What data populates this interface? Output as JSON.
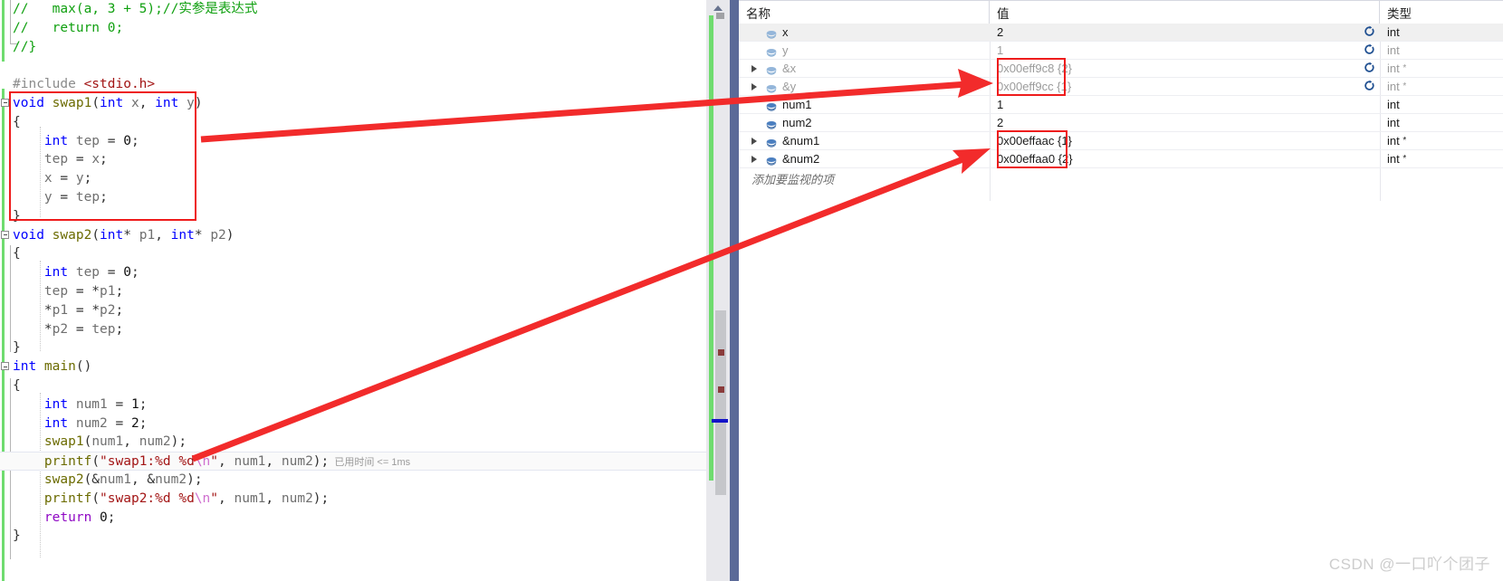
{
  "editor": {
    "lines": [
      {
        "indent": 0,
        "fold": false,
        "tokens": [
          {
            "t": "//   max(a, 3 + 5);//实参是表达式",
            "c": "c-com"
          }
        ]
      },
      {
        "indent": 0,
        "fold": false,
        "tokens": [
          {
            "t": "//   return 0;",
            "c": "c-com"
          }
        ]
      },
      {
        "indent": 0,
        "fold": false,
        "tokens": [
          {
            "t": "//}",
            "c": "c-com"
          }
        ]
      },
      {
        "indent": 0,
        "fold": false,
        "tokens": []
      },
      {
        "indent": 0,
        "fold": false,
        "tokens": [
          {
            "t": "#include ",
            "c": "c-pre"
          },
          {
            "t": "<stdio.h>",
            "c": "c-hdr"
          }
        ]
      },
      {
        "indent": 0,
        "fold": true,
        "tokens": [
          {
            "t": "void ",
            "c": "c-key"
          },
          {
            "t": "swap1",
            "c": "c-fn"
          },
          {
            "t": "(",
            "c": "c-pun"
          },
          {
            "t": "int ",
            "c": "c-key"
          },
          {
            "t": "x",
            "c": "c-id"
          },
          {
            "t": ", ",
            "c": "c-pun"
          },
          {
            "t": "int ",
            "c": "c-key"
          },
          {
            "t": "y",
            "c": "c-id"
          },
          {
            "t": ")",
            "c": "c-pun"
          }
        ]
      },
      {
        "indent": 0,
        "fold": false,
        "tokens": [
          {
            "t": "{",
            "c": "c-pun"
          }
        ]
      },
      {
        "indent": 0,
        "fold": false,
        "tokens": [
          {
            "t": "    int ",
            "c": "c-key"
          },
          {
            "t": "tep",
            "c": "c-id"
          },
          {
            "t": " = ",
            "c": "c-pun"
          },
          {
            "t": "0",
            "c": "c-num"
          },
          {
            "t": ";",
            "c": "c-pun"
          }
        ]
      },
      {
        "indent": 0,
        "fold": false,
        "tokens": [
          {
            "t": "    tep",
            "c": "c-id"
          },
          {
            "t": " = ",
            "c": "c-pun"
          },
          {
            "t": "x",
            "c": "c-id"
          },
          {
            "t": ";",
            "c": "c-pun"
          }
        ]
      },
      {
        "indent": 0,
        "fold": false,
        "tokens": [
          {
            "t": "    x",
            "c": "c-id"
          },
          {
            "t": " = ",
            "c": "c-pun"
          },
          {
            "t": "y",
            "c": "c-id"
          },
          {
            "t": ";",
            "c": "c-pun"
          }
        ]
      },
      {
        "indent": 0,
        "fold": false,
        "tokens": [
          {
            "t": "    y",
            "c": "c-id"
          },
          {
            "t": " = ",
            "c": "c-pun"
          },
          {
            "t": "tep",
            "c": "c-id"
          },
          {
            "t": ";",
            "c": "c-pun"
          }
        ]
      },
      {
        "indent": 0,
        "fold": false,
        "tokens": [
          {
            "t": "}",
            "c": "c-pun"
          }
        ]
      },
      {
        "indent": 0,
        "fold": true,
        "tokens": [
          {
            "t": "void ",
            "c": "c-key"
          },
          {
            "t": "swap2",
            "c": "c-fn"
          },
          {
            "t": "(",
            "c": "c-pun"
          },
          {
            "t": "int",
            "c": "c-key"
          },
          {
            "t": "* ",
            "c": "c-pun"
          },
          {
            "t": "p1",
            "c": "c-id"
          },
          {
            "t": ", ",
            "c": "c-pun"
          },
          {
            "t": "int",
            "c": "c-key"
          },
          {
            "t": "* ",
            "c": "c-pun"
          },
          {
            "t": "p2",
            "c": "c-id"
          },
          {
            "t": ")",
            "c": "c-pun"
          }
        ]
      },
      {
        "indent": 0,
        "fold": false,
        "tokens": [
          {
            "t": "{",
            "c": "c-pun"
          }
        ]
      },
      {
        "indent": 0,
        "fold": false,
        "tokens": [
          {
            "t": "    int ",
            "c": "c-key"
          },
          {
            "t": "tep",
            "c": "c-id"
          },
          {
            "t": " = ",
            "c": "c-pun"
          },
          {
            "t": "0",
            "c": "c-num"
          },
          {
            "t": ";",
            "c": "c-pun"
          }
        ]
      },
      {
        "indent": 0,
        "fold": false,
        "tokens": [
          {
            "t": "    tep",
            "c": "c-id"
          },
          {
            "t": " = *",
            "c": "c-pun"
          },
          {
            "t": "p1",
            "c": "c-id"
          },
          {
            "t": ";",
            "c": "c-pun"
          }
        ]
      },
      {
        "indent": 0,
        "fold": false,
        "tokens": [
          {
            "t": "    *",
            "c": "c-pun"
          },
          {
            "t": "p1",
            "c": "c-id"
          },
          {
            "t": " = *",
            "c": "c-pun"
          },
          {
            "t": "p2",
            "c": "c-id"
          },
          {
            "t": ";",
            "c": "c-pun"
          }
        ]
      },
      {
        "indent": 0,
        "fold": false,
        "tokens": [
          {
            "t": "    *",
            "c": "c-pun"
          },
          {
            "t": "p2",
            "c": "c-id"
          },
          {
            "t": " = ",
            "c": "c-pun"
          },
          {
            "t": "tep",
            "c": "c-id"
          },
          {
            "t": ";",
            "c": "c-pun"
          }
        ]
      },
      {
        "indent": 0,
        "fold": false,
        "tokens": [
          {
            "t": "}",
            "c": "c-pun"
          }
        ]
      },
      {
        "indent": 0,
        "fold": true,
        "tokens": [
          {
            "t": "int ",
            "c": "c-key"
          },
          {
            "t": "main",
            "c": "c-fn"
          },
          {
            "t": "()",
            "c": "c-pun"
          }
        ]
      },
      {
        "indent": 0,
        "fold": false,
        "tokens": [
          {
            "t": "{",
            "c": "c-pun"
          }
        ]
      },
      {
        "indent": 0,
        "fold": false,
        "tokens": [
          {
            "t": "    int ",
            "c": "c-key"
          },
          {
            "t": "num1",
            "c": "c-id"
          },
          {
            "t": " = ",
            "c": "c-pun"
          },
          {
            "t": "1",
            "c": "c-num"
          },
          {
            "t": ";",
            "c": "c-pun"
          }
        ]
      },
      {
        "indent": 0,
        "fold": false,
        "tokens": [
          {
            "t": "    int ",
            "c": "c-key"
          },
          {
            "t": "num2",
            "c": "c-id"
          },
          {
            "t": " = ",
            "c": "c-pun"
          },
          {
            "t": "2",
            "c": "c-num"
          },
          {
            "t": ";",
            "c": "c-pun"
          }
        ]
      },
      {
        "indent": 0,
        "fold": false,
        "tokens": [
          {
            "t": "    ",
            "c": "c-pun"
          },
          {
            "t": "swap1",
            "c": "c-fn"
          },
          {
            "t": "(",
            "c": "c-pun"
          },
          {
            "t": "num1",
            "c": "c-id"
          },
          {
            "t": ", ",
            "c": "c-pun"
          },
          {
            "t": "num2",
            "c": "c-id"
          },
          {
            "t": ");",
            "c": "c-pun"
          }
        ]
      },
      {
        "indent": 0,
        "fold": false,
        "highlight": true,
        "tokens": [
          {
            "t": "    ",
            "c": "c-pun"
          },
          {
            "t": "printf",
            "c": "c-fn"
          },
          {
            "t": "(",
            "c": "c-pun"
          },
          {
            "t": "\"swap1:%d %d",
            "c": "c-str"
          },
          {
            "t": "\\n",
            "c": "c-esc"
          },
          {
            "t": "\"",
            "c": "c-str"
          },
          {
            "t": ", ",
            "c": "c-pun"
          },
          {
            "t": "num1",
            "c": "c-id"
          },
          {
            "t": ", ",
            "c": "c-pun"
          },
          {
            "t": "num2",
            "c": "c-id"
          },
          {
            "t": ");",
            "c": "c-pun"
          }
        ],
        "elapsed": "已用时间 <= 1ms"
      },
      {
        "indent": 0,
        "fold": false,
        "tokens": [
          {
            "t": "    ",
            "c": "c-pun"
          },
          {
            "t": "swap2",
            "c": "c-fn"
          },
          {
            "t": "(&",
            "c": "c-pun"
          },
          {
            "t": "num1",
            "c": "c-id"
          },
          {
            "t": ", &",
            "c": "c-pun"
          },
          {
            "t": "num2",
            "c": "c-id"
          },
          {
            "t": ");",
            "c": "c-pun"
          }
        ]
      },
      {
        "indent": 0,
        "fold": false,
        "tokens": [
          {
            "t": "    ",
            "c": "c-pun"
          },
          {
            "t": "printf",
            "c": "c-fn"
          },
          {
            "t": "(",
            "c": "c-pun"
          },
          {
            "t": "\"swap2:%d %d",
            "c": "c-str"
          },
          {
            "t": "\\n",
            "c": "c-esc"
          },
          {
            "t": "\"",
            "c": "c-str"
          },
          {
            "t": ", ",
            "c": "c-pun"
          },
          {
            "t": "num1",
            "c": "c-id"
          },
          {
            "t": ", ",
            "c": "c-pun"
          },
          {
            "t": "num2",
            "c": "c-id"
          },
          {
            "t": ");",
            "c": "c-pun"
          }
        ]
      },
      {
        "indent": 0,
        "fold": false,
        "tokens": [
          {
            "t": "    return ",
            "c": "c-ctl"
          },
          {
            "t": "0",
            "c": "c-num"
          },
          {
            "t": ";",
            "c": "c-pun"
          }
        ]
      },
      {
        "indent": 0,
        "fold": false,
        "tokens": [
          {
            "t": "}",
            "c": "c-pun"
          }
        ]
      }
    ]
  },
  "watch": {
    "columns": {
      "name": "名称",
      "value": "值",
      "type": "类型"
    },
    "placeholder": "添加要监视的项",
    "rows": [
      {
        "name": "x",
        "value": "2",
        "extra": "",
        "type": "int",
        "pointer": false,
        "expandable": false,
        "dimmed": false,
        "selected": true,
        "refresh": true,
        "dark_icon": false
      },
      {
        "name": "y",
        "value": "1",
        "extra": "",
        "type": "int",
        "pointer": false,
        "expandable": false,
        "dimmed": true,
        "selected": false,
        "refresh": true,
        "dark_icon": false
      },
      {
        "name": "&x",
        "value": "0x00eff9c8",
        "extra": " {2}",
        "type": "int",
        "pointer": true,
        "expandable": true,
        "dimmed": true,
        "selected": false,
        "refresh": true,
        "dark_icon": false
      },
      {
        "name": "&y",
        "value": "0x00eff9cc",
        "extra": " {1}",
        "type": "int",
        "pointer": true,
        "expandable": true,
        "dimmed": true,
        "selected": false,
        "refresh": true,
        "dark_icon": false
      },
      {
        "name": "num1",
        "value": "1",
        "extra": "",
        "type": "int",
        "pointer": false,
        "expandable": false,
        "dimmed": false,
        "selected": false,
        "refresh": false,
        "dark_icon": true
      },
      {
        "name": "num2",
        "value": "2",
        "extra": "",
        "type": "int",
        "pointer": false,
        "expandable": false,
        "dimmed": false,
        "selected": false,
        "refresh": false,
        "dark_icon": true
      },
      {
        "name": "&num1",
        "value": "0x00effaac",
        "extra": " {1}",
        "type": "int",
        "pointer": true,
        "expandable": true,
        "dimmed": false,
        "selected": false,
        "refresh": false,
        "dark_icon": true
      },
      {
        "name": "&num2",
        "value": "0x00effaa0",
        "extra": " {2}",
        "type": "int",
        "pointer": true,
        "expandable": true,
        "dimmed": false,
        "selected": false,
        "refresh": false,
        "dark_icon": true
      }
    ]
  },
  "annotations": {
    "box_color": "#ee1c1c",
    "arrow_color": "#f22b2b",
    "code_box_label": "swap1-body-highlight-box",
    "watch_box_1_label": "address-of-x-y-highlight-box",
    "watch_box_2_label": "address-of-num1-num2-highlight-box"
  },
  "watermark": {
    "text": "CSDN @一口吖个团子"
  }
}
